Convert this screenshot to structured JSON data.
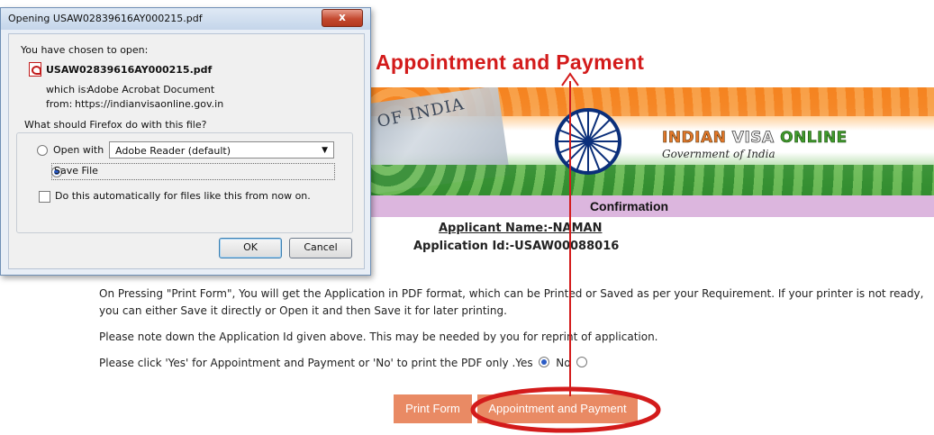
{
  "annotation": {
    "label": "Appointment and Payment",
    "color": "#d31b1b"
  },
  "banner": {
    "passport_text": "OF INDIA",
    "brand_word1": "INDIAN",
    "brand_word2": "VISA",
    "brand_word3": "ONLINE",
    "subtitle": "Government of India"
  },
  "confirmation": {
    "heading": "Confirmation",
    "applicant_name": "Applicant Name:-NAMAN",
    "application_id": "Application Id:-USAW00088016",
    "paragraph1": "On Pressing \"Print Form\", You will get the Application in PDF format, which can be Printed or Saved as per your Requirement. If your printer is not ready,",
    "paragraph1b": "you can either Save it directly or Open it and then Save it for later printing.",
    "paragraph2": "Please note down the Application Id given above. This may be needed by you for reprint of application.",
    "question": "Please click 'Yes' for Appointment and Payment or 'No' to print the PDF only .Yes",
    "no_label": "No",
    "yes_selected": true,
    "print_button": "Print Form",
    "appointment_button": "Appointment and Payment",
    "button_color": "#e98a64"
  },
  "dialog": {
    "title": "Opening USAW02839616AY000215.pdf",
    "close_label": "x",
    "chosen_label": "You have chosen to open:",
    "filename": "USAW02839616AY000215.pdf",
    "which_is_label": "which is:",
    "which_is_value": "Adobe Acrobat Document",
    "from_label": "from:",
    "from_value": "https://indianvisaonline.gov.in",
    "question": "What should Firefox do with this file?",
    "open_with_label": "Open with",
    "open_with_app": "Adobe Reader  (default)",
    "save_file_label": "Save File",
    "auto_label": "Do this automatically for files like this from now on.",
    "ok_label": "OK",
    "cancel_label": "Cancel",
    "selected_option": "Save File"
  }
}
